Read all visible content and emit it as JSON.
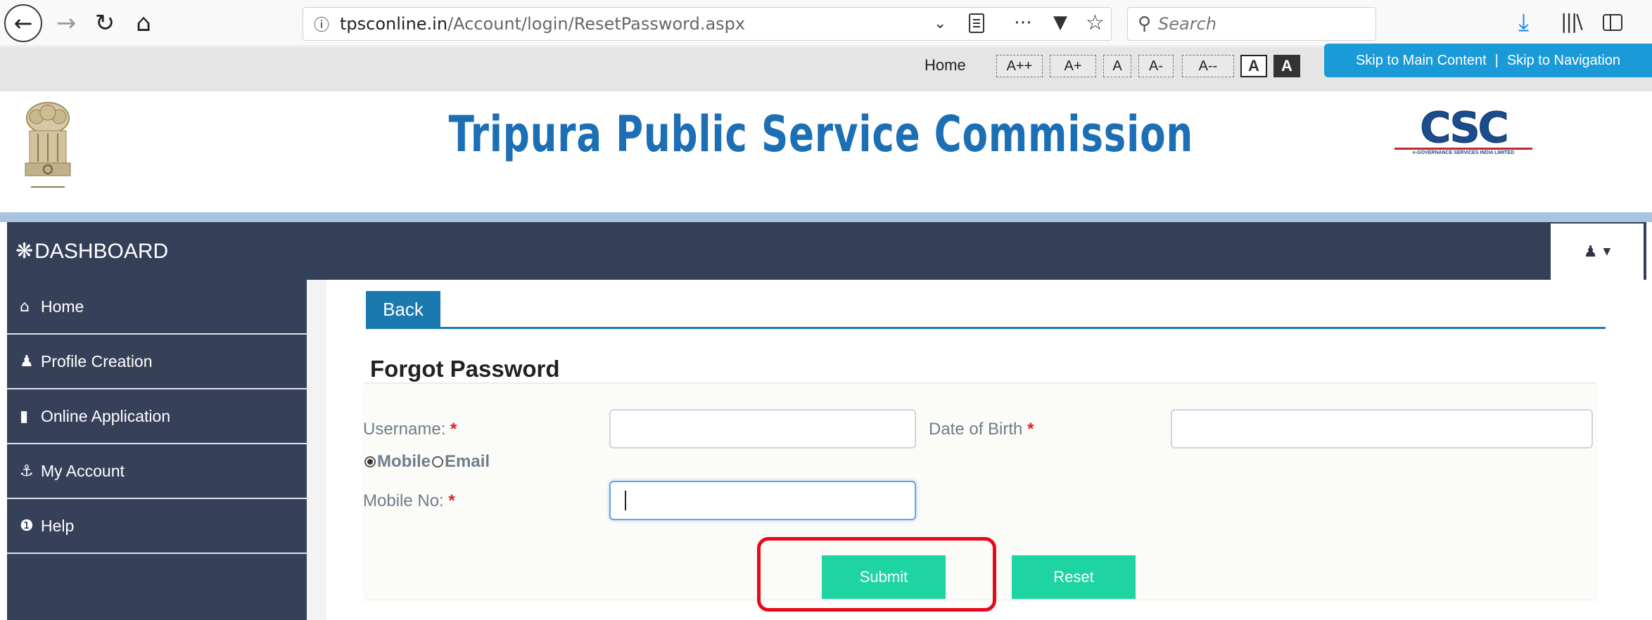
{
  "browser": {
    "url_host": "tpsconline.in",
    "url_path": "/Account/login/ResetPassword.aspx",
    "search_placeholder": "Search",
    "icons": [
      "back-arrow-icon",
      "forward-arrow-icon",
      "reload-icon",
      "home-icon",
      "info-icon",
      "dropdown-chevron-icon",
      "reader-view-icon",
      "more-icon",
      "pocket-icon",
      "bookmark-star-icon",
      "search-icon",
      "download-icon",
      "library-icon",
      "sidebar-icon"
    ]
  },
  "utility": {
    "home": "Home",
    "font_sizes": [
      "A++",
      "A+",
      "A",
      "A-",
      "A--"
    ],
    "contrast_light": "A",
    "contrast_dark": "A",
    "skip_main": "Skip to Main Content",
    "separator": "|",
    "skip_nav": "Skip to Navigation"
  },
  "header": {
    "title": "Tripura Public Service Commission",
    "partner_logo_text": "CSC",
    "partner_logo_sub": "e-GOVERNANCE SERVICES INDIA LIMITED"
  },
  "dashboard": {
    "title": "DASHBOARD"
  },
  "sidebar": {
    "items": [
      {
        "label": "Home",
        "icon": "home-icon"
      },
      {
        "label": "Profile Creation",
        "icon": "user-icon"
      },
      {
        "label": "Online Application",
        "icon": "file-icon"
      },
      {
        "label": "My Account",
        "icon": "account-icon"
      },
      {
        "label": "Help",
        "icon": "info-icon"
      }
    ]
  },
  "main": {
    "back_tab": "Back",
    "heading": "Forgot Password",
    "username_label": "Username:",
    "dob_label": "Date of Birth",
    "required_mark": "*",
    "radio_mobile": "Mobile",
    "radio_email": "Email",
    "selected_contact": "Mobile",
    "mobile_label": "Mobile No:",
    "username_value": "",
    "dob_value": "",
    "mobile_value": "",
    "submit": "Submit",
    "reset": "Reset"
  },
  "colors": {
    "title_blue": "#1c6fb5",
    "nav_dark": "#364159",
    "tab_blue": "#1a7ab0",
    "button_green": "#1ed4a0",
    "highlight_red": "#e8091a",
    "skip_blue": "#1a9bd7"
  }
}
